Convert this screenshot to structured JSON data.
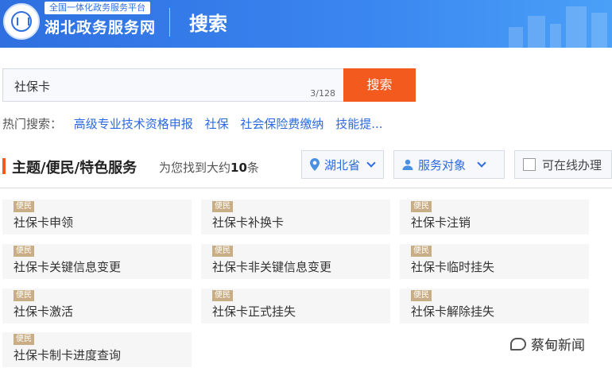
{
  "header": {
    "platform_tag": "全国一体化政务服务平台",
    "site_name": "湖北政务服务网",
    "page_title": "搜索"
  },
  "search": {
    "value": "社保卡",
    "counter": "3/128",
    "button_label": "搜索"
  },
  "hot_search": {
    "label": "热门搜索：",
    "items": [
      "高级专业技术资格申报",
      "社保",
      "社会保险费缴纳",
      "技能提..."
    ]
  },
  "section": {
    "title": "主题/便民/特色服务",
    "result_prefix": "为您找到大约",
    "result_count": "10",
    "result_suffix": "条"
  },
  "filters": {
    "region": "湖北省",
    "audience": "服务对象",
    "online": "可在线办理"
  },
  "results": [
    {
      "tag": "便民",
      "title": "社保卡申领"
    },
    {
      "tag": "便民",
      "title": "社保卡补换卡"
    },
    {
      "tag": "便民",
      "title": "社保卡注销"
    },
    {
      "tag": "便民",
      "title": "社保卡关键信息变更"
    },
    {
      "tag": "便民",
      "title": "社保卡非关键信息变更"
    },
    {
      "tag": "便民",
      "title": "社保卡临时挂失"
    },
    {
      "tag": "便民",
      "title": "社保卡激活"
    },
    {
      "tag": "便民",
      "title": "社保卡正式挂失"
    },
    {
      "tag": "便民",
      "title": "社保卡解除挂失"
    },
    {
      "tag": "便民",
      "title": "社保卡制卡进度查询"
    }
  ],
  "watermark": "蔡甸新闻",
  "colors": {
    "header_blue": "#2f6fe0",
    "accent_orange": "#f25a1e",
    "link_blue": "#2b6ae0",
    "tag_tan": "#c9ad84"
  }
}
